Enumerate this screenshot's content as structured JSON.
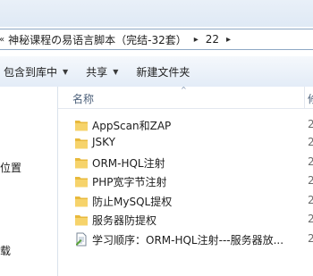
{
  "address_bar": {
    "back_arrow": "«",
    "path": [
      "神秘课程の易语言脚本（完结-32套）",
      "22"
    ]
  },
  "toolbar": {
    "include_in_library": "包含到库中",
    "share": "共享",
    "new_folder": "新建文件夹"
  },
  "nav": {
    "items": [
      "的位置",
      "下载"
    ]
  },
  "columns": {
    "name": "名称",
    "date_partial": "修"
  },
  "files": [
    {
      "name": "AppScan和ZAP",
      "type": "folder",
      "date_partial": "2"
    },
    {
      "name": "JSKY",
      "type": "folder",
      "date_partial": "2"
    },
    {
      "name": "ORM-HQL注射",
      "type": "folder",
      "date_partial": "2"
    },
    {
      "name": "PHP宽字节注射",
      "type": "folder",
      "date_partial": "2"
    },
    {
      "name": "防止MySQL提权",
      "type": "folder",
      "date_partial": "2"
    },
    {
      "name": "服务器防提权",
      "type": "folder",
      "date_partial": "2"
    },
    {
      "name": "学习顺序：ORM-HQL注射---服务器放...",
      "type": "text-document",
      "date_partial": "2"
    }
  ],
  "colors": {
    "folder_yellow": "#e8b93c",
    "header_text": "#4c607a",
    "toolbar_gradient_top": "#f5f8fc",
    "toolbar_gradient_bottom": "#e3ecf7"
  }
}
